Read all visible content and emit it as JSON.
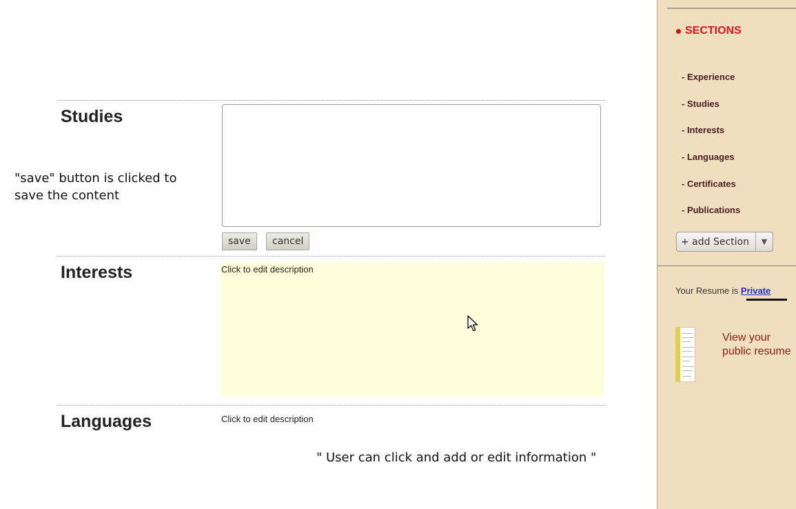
{
  "sections": [
    {
      "title": "Studies"
    },
    {
      "title": "Interests",
      "description": "Click to edit description"
    },
    {
      "title": "Languages",
      "description": "Click to edit description"
    }
  ],
  "studies_editor": {
    "value": "",
    "save_label": "save",
    "cancel_label": "cancel"
  },
  "annotations": {
    "save_note_line1": "\"save\" button is clicked to",
    "save_note_line2": "save the content",
    "edit_note": "\" User can click and add or edit information \""
  },
  "sidebar": {
    "heading": "SECTIONS",
    "items": [
      {
        "label": "- Experience"
      },
      {
        "label": "- Studies"
      },
      {
        "label": "- Interests"
      },
      {
        "label": "- Languages"
      },
      {
        "label": "- Certificates"
      },
      {
        "label": "- Publications"
      }
    ],
    "add_section_label": "+ add Section",
    "privacy_prefix": "Your Resume is ",
    "privacy_value": "Private",
    "view_public_line1": "View your",
    "view_public_line2": "public resume"
  },
  "colors": {
    "accent_red": "#e0141d",
    "sidebar_bg": "#f0dfbe",
    "highlight_bg": "#ffffdb",
    "link_blue": "#1a2fd6"
  },
  "icons": {
    "bullet": "bullet-dot-icon",
    "dropdown": "triangle-down-icon",
    "cursor": "mouse-pointer-icon",
    "thumbnail": "resume-thumbnail-icon"
  }
}
